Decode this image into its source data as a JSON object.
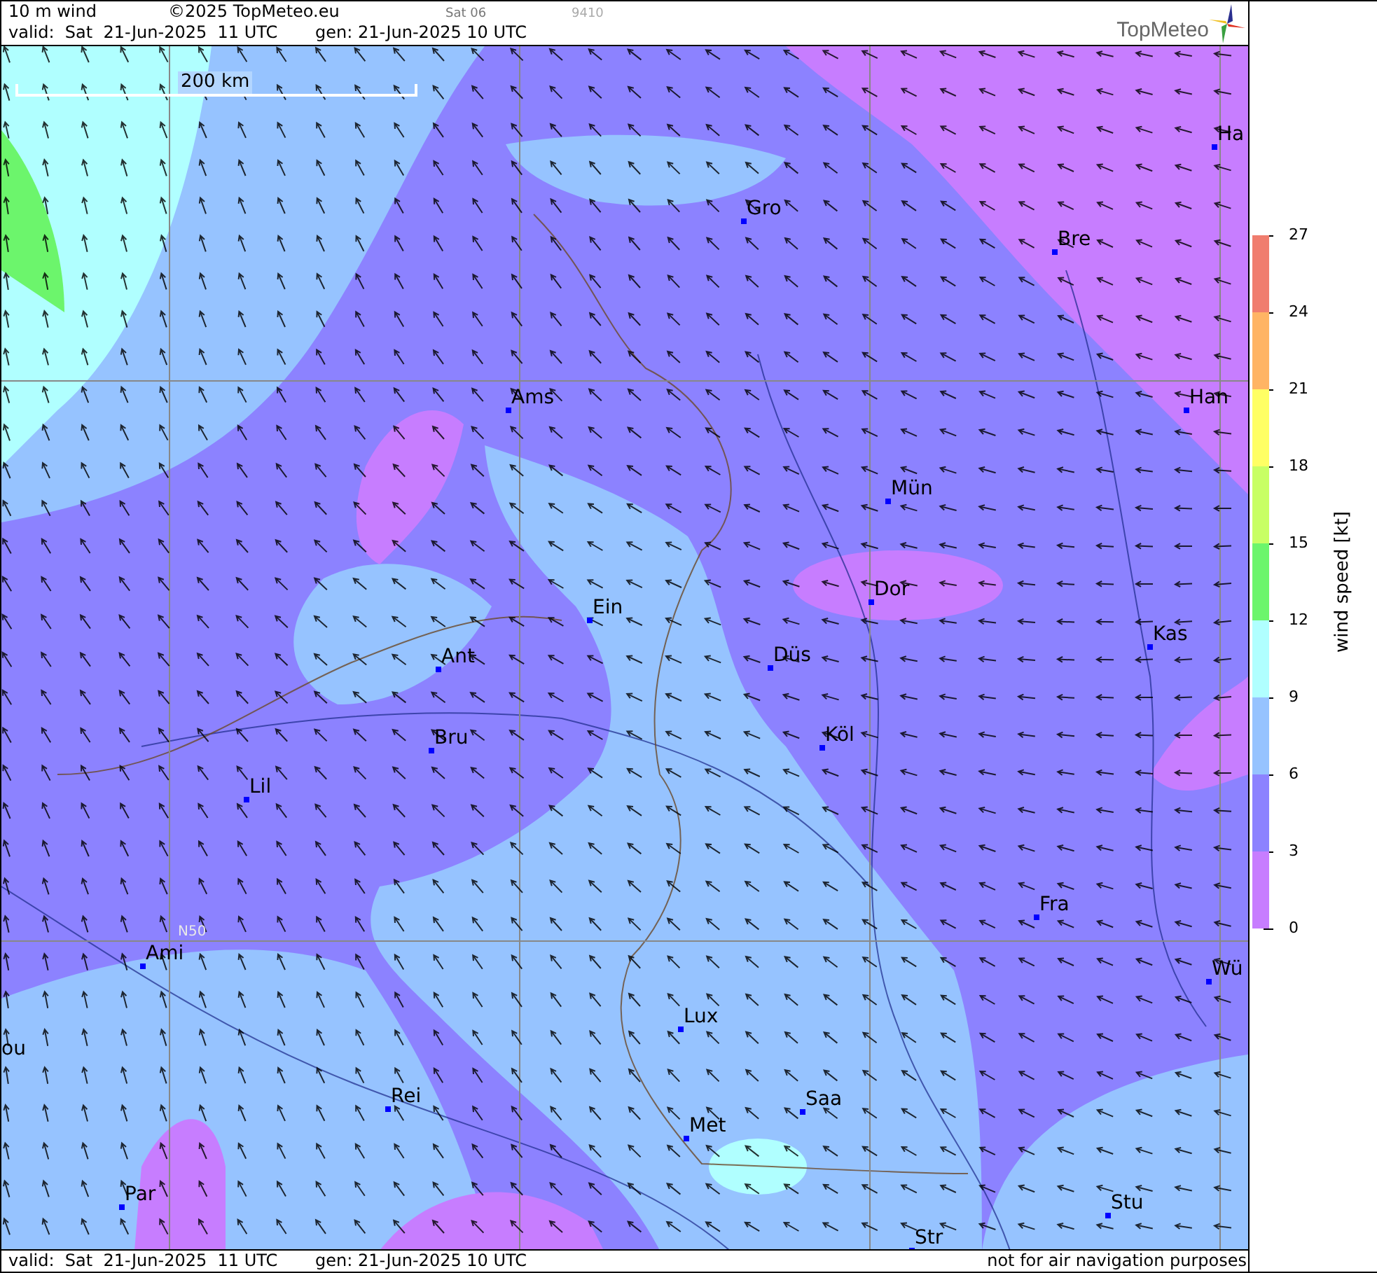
{
  "header": {
    "title": "10 m wind",
    "copyright": "©2025 TopMeteo.eu",
    "run": "Sat 06",
    "code": "9410",
    "valid": "valid:  Sat  21-Jun-2025  11 UTC",
    "generated": "gen: 21-Jun-2025 10 UTC",
    "logo": "TopMeteo"
  },
  "map": {
    "scale": "200 km",
    "grid_label": "N50",
    "cities": [
      "Ha",
      "Gro",
      "Bre",
      "Ams",
      "Han",
      "Mün",
      "Dor",
      "Ein",
      "Kas",
      "Ant",
      "Düs",
      "Bru",
      "Köl",
      "Lil",
      "Fra",
      "Ami",
      "Wü",
      "ou",
      "Lux",
      "Rei",
      "Saa",
      "Met",
      "Par",
      "Stu",
      "Str"
    ]
  },
  "legend": {
    "title": "wind speed [kt]",
    "ticks": [
      "27",
      "24",
      "21",
      "18",
      "15",
      "12",
      "9",
      "6",
      "3",
      "0"
    ],
    "bands": [
      {
        "color": "#f07d6e"
      },
      {
        "color": "#ffb464"
      },
      {
        "color": "#ffff64"
      },
      {
        "color": "#c8ff64"
      },
      {
        "color": "#6cf56c"
      },
      {
        "color": "#b0ffff"
      },
      {
        "color": "#96c3ff"
      },
      {
        "color": "#8c82ff"
      },
      {
        "color": "#c77dff"
      }
    ]
  },
  "footer": {
    "valid": "valid:  Sat  21-Jun-2025  11 UTC",
    "generated": "gen: 21-Jun-2025 10 UTC",
    "note": "not for air navigation purposes"
  }
}
